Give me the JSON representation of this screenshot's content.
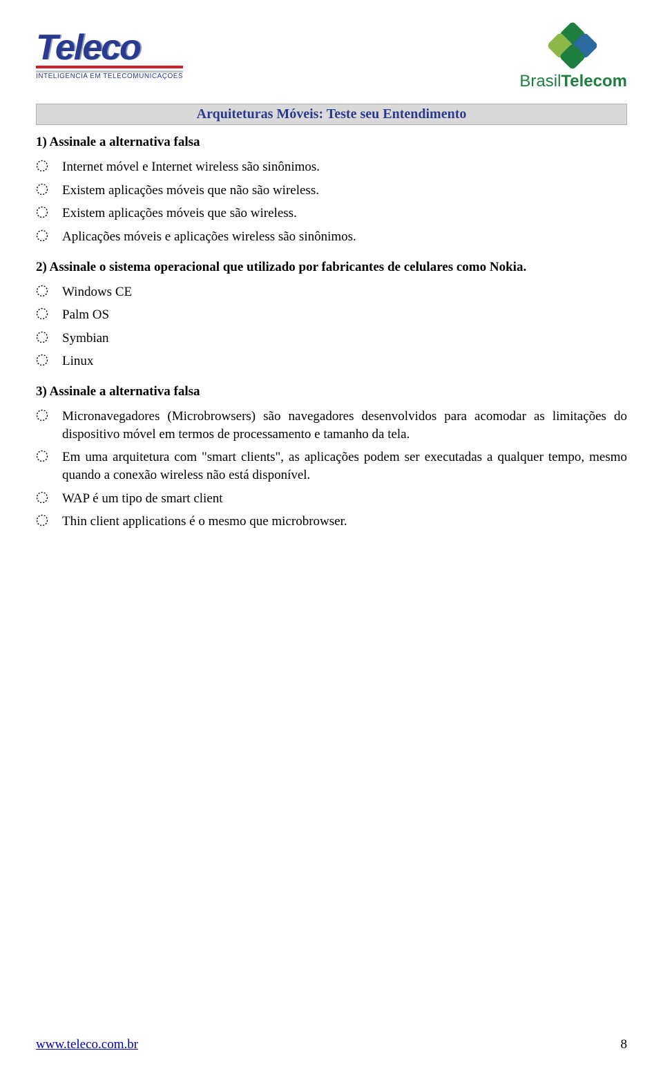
{
  "logos": {
    "teleco_text": "Teleco",
    "teleco_sub": "INTELIGÊNCIA EM TELECOMUNICAÇÕES",
    "brasiltelecom_prefix": "Brasil",
    "brasiltelecom_bold": "Telecom"
  },
  "title": "Arquiteturas Móveis: Teste seu Entendimento",
  "questions": [
    {
      "prompt": "1) Assinale a alternativa falsa",
      "options": [
        "Internet móvel e Internet wireless são sinônimos.",
        "Existem aplicações móveis que não são wireless.",
        "Existem aplicações móveis que são wireless.",
        "Aplicações móveis e aplicações wireless são sinônimos."
      ]
    },
    {
      "prompt": "2) Assinale o sistema operacional que utilizado por fabricantes de celulares como Nokia.",
      "options": [
        "Windows CE",
        "Palm OS",
        "Symbian",
        "Linux"
      ]
    },
    {
      "prompt": "3) Assinale a alternativa falsa",
      "options": [
        "Micronavegadores (Microbrowsers) são navegadores desenvolvidos para acomodar as limitações do dispositivo móvel em termos de processamento e tamanho da tela.",
        "Em uma arquitetura com \"smart clients\", as aplicações podem ser executadas a qualquer tempo, mesmo quando a conexão wireless não está disponível.",
        "WAP é um tipo de smart client",
        "Thin client applications é o mesmo que microbrowser."
      ]
    }
  ],
  "footer": {
    "url": "www.teleco.com.br",
    "page": "8"
  }
}
